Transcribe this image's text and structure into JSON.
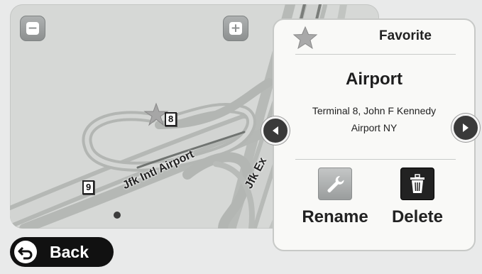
{
  "map": {
    "shield_top": "8",
    "shield_left": "9",
    "road_label_main": "Jfk Intl Airport",
    "road_label_exit": "Jfk Ex"
  },
  "zoom": {
    "out_icon": "minus-icon",
    "in_icon": "plus-icon"
  },
  "favorite_panel": {
    "header": "Favorite",
    "header_icon": "star-icon",
    "name": "Airport",
    "address_line1": "Terminal 8, John F Kennedy",
    "address_line2": "Airport NY",
    "rename_label": "Rename",
    "rename_icon": "wrench-icon",
    "delete_label": "Delete",
    "delete_icon": "trash-icon"
  },
  "navigation": {
    "prev_icon": "left-arrow-icon",
    "next_icon": "right-arrow-icon"
  },
  "back": {
    "label": "Back",
    "icon": "back-arrow-icon"
  },
  "colors": {
    "map_background": "#d6d8d6",
    "road": "#b5b8b5",
    "panel": "#f9f9f7",
    "button_dark": "#111111"
  }
}
